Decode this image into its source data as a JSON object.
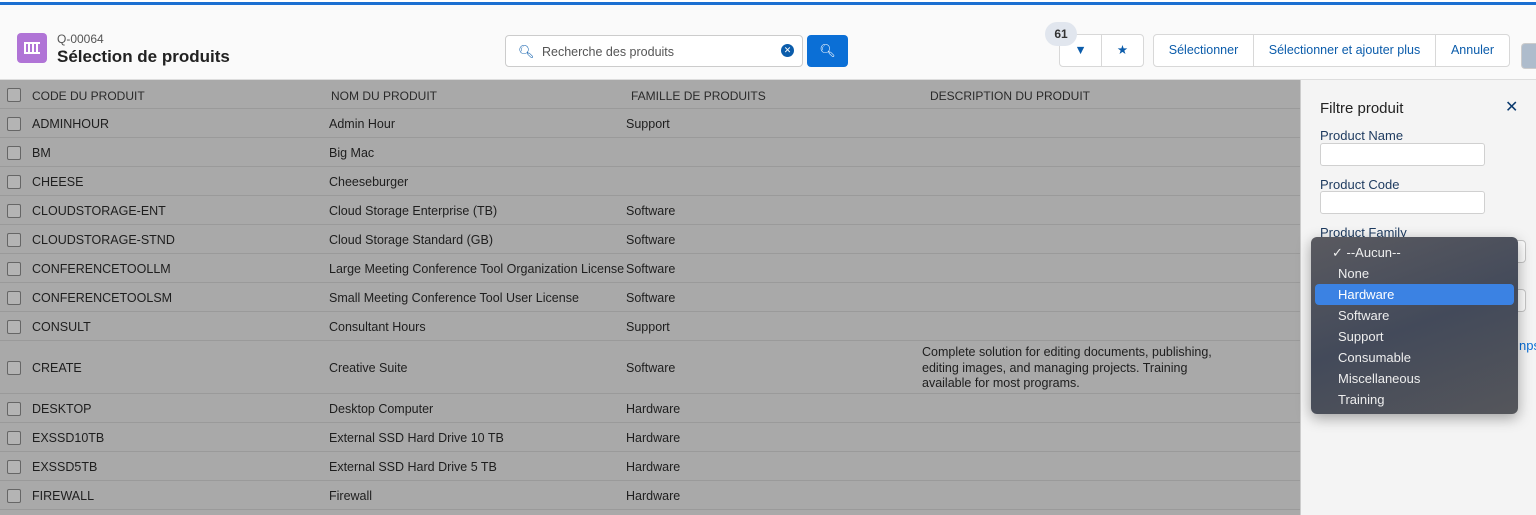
{
  "header": {
    "record_id": "Q-00064",
    "title": "Sélection de produits",
    "search_placeholder": "Recherche des produits",
    "result_count": "61",
    "buttons": [
      "Sélectionner",
      "Sélectionner et ajouter plus",
      "Annuler"
    ]
  },
  "table": {
    "columns": [
      "CODE DU PRODUIT",
      "NOM DU PRODUIT",
      "FAMILLE DE PRODUITS",
      "DESCRIPTION DU PRODUIT"
    ],
    "rows": [
      {
        "code": "ADMINHOUR",
        "name": "Admin Hour",
        "family": "Support",
        "desc": ""
      },
      {
        "code": "BM",
        "name": "Big Mac",
        "family": "",
        "desc": ""
      },
      {
        "code": "CHEESE",
        "name": "Cheeseburger",
        "family": "",
        "desc": ""
      },
      {
        "code": "CLOUDSTORAGE-ENT",
        "name": "Cloud Storage Enterprise (TB)",
        "family": "Software",
        "desc": ""
      },
      {
        "code": "CLOUDSTORAGE-STND",
        "name": "Cloud Storage Standard (GB)",
        "family": "Software",
        "desc": ""
      },
      {
        "code": "CONFERENCETOOLLM",
        "name": "Large Meeting Conference Tool Organization License",
        "family": "Software",
        "desc": ""
      },
      {
        "code": "CONFERENCETOOLSM",
        "name": "Small Meeting Conference Tool User License",
        "family": "Software",
        "desc": ""
      },
      {
        "code": "CONSULT",
        "name": "Consultant Hours",
        "family": "Support",
        "desc": ""
      },
      {
        "code": "CREATE",
        "name": "Creative Suite",
        "family": "Software",
        "desc": "Complete solution for editing documents, publishing, editing images, and managing projects. Training available for most programs."
      },
      {
        "code": "DESKTOP",
        "name": "Desktop Computer",
        "family": "Hardware",
        "desc": ""
      },
      {
        "code": "EXSSD10TB",
        "name": "External SSD Hard Drive 10 TB",
        "family": "Hardware",
        "desc": ""
      },
      {
        "code": "EXSSD5TB",
        "name": "External SSD Hard Drive 5 TB",
        "family": "Hardware",
        "desc": ""
      },
      {
        "code": "FIREWALL",
        "name": "Firewall",
        "family": "Hardware",
        "desc": ""
      }
    ]
  },
  "filter": {
    "title": "Filtre produit",
    "product_name_label": "Product Name",
    "product_code_label": "Product Code",
    "product_family_label": "Product Family",
    "link_fragment": "nps",
    "options": [
      "✓ --Aucun--",
      "None",
      "Hardware",
      "Software",
      "Support",
      "Consumable",
      "Miscellaneous",
      "Training"
    ],
    "highlighted": "Hardware"
  }
}
